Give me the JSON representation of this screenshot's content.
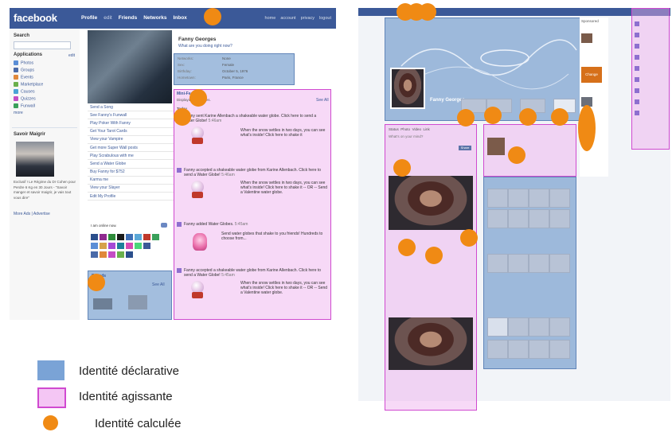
{
  "old_profile": {
    "logo": "facebook",
    "nav": [
      "Profile",
      "edit",
      "Friends",
      "Networks",
      "Inbox"
    ],
    "nav_right": [
      "home",
      "account",
      "privacy",
      "logout"
    ],
    "search_label": "Search",
    "applications_label": "Applications",
    "applications_edit": "edit",
    "applications": [
      "Photos",
      "Groups",
      "Events",
      "Marketplace",
      "Causes",
      "Quizzes",
      "Funwall"
    ],
    "more_label": "more",
    "ad_title": "Savoir Maigrir",
    "ad_text": "Exclusif ! Le Régime du Dr Cohen pour Perdre 6 Kg en 30 Jours - \"Savoir manger et savoir maigrir, je vais tout vous dire\"",
    "ad_links": "More Ads | Advertise",
    "profile_name": "Fanny Georges",
    "status_prompt": "What are you doing right now?",
    "info_rows": [
      {
        "k": "Networks:",
        "v": "None"
      },
      {
        "k": "Sex:",
        "v": "Female"
      },
      {
        "k": "Birthday:",
        "v": "October 5, 1976"
      },
      {
        "k": "Hometown:",
        "v": "Paris, France"
      }
    ],
    "actions": [
      "Send a Song",
      "See Fanny's Funwall",
      "Play Poker With Fanny",
      "Get Your Tarot Cards",
      "View your Vampire",
      "Get more Super Wall posts",
      "Play Scrabulous with me",
      "Send a Water Globe",
      "Buy Fanny for $752",
      "Karma me",
      "View your Slayer",
      "Edit My Profile"
    ],
    "online_label": "I am online now.",
    "friends_label": "Friends",
    "see_all": "See All",
    "minifeed_label": "Mini-Feed",
    "minifeed_sub": "Displaying 10 stories.",
    "feed_see_all": "See All",
    "feed_day": "Today",
    "feed": [
      {
        "text": "Fanny sent Karine Allenbach a shakeable water globe. Click here to send a Water Globe!",
        "time": "5:46am",
        "sub": "When the snow settles in two days, you can see what's inside! Click here to shake it"
      },
      {
        "text": "Fanny accepted a shakeable water globe from Karine Allenbach. Click here to send a Water Globe!",
        "time": "5:46am",
        "sub": "When the snow settles in two days, you can see what's inside! Click here to shake it -- OR -- Send a Valentine water globe."
      },
      {
        "text": "Fanny added Water Globes.",
        "time": "5:45am",
        "sub": "Send water globes that shake to you friends! Hundreds to choose from..."
      },
      {
        "text": "Fanny accepted a shakeable water globe from Karine Allenbach. Click here to send a Water Globe!",
        "time": "5:45am",
        "sub": "When the snow settles in two days, you can see what's inside! Click here to shake it -- OR -- Send a Valentine water globe."
      }
    ]
  },
  "new_profile": {
    "name": "Fanny Georges",
    "tabs": [
      "Status",
      "Photo",
      "Video",
      "Link"
    ],
    "prompt": "What's on your mind?",
    "share_button": "Share",
    "sponsored": "Sponsored",
    "change_ad": "Change"
  },
  "legend": [
    {
      "label": "Identité déclarative",
      "color": "#7aa3d6"
    },
    {
      "label": "Identité agissante",
      "color": "#f4c6f4"
    },
    {
      "label": "Identité calculée",
      "color": "#f08a14"
    }
  ]
}
